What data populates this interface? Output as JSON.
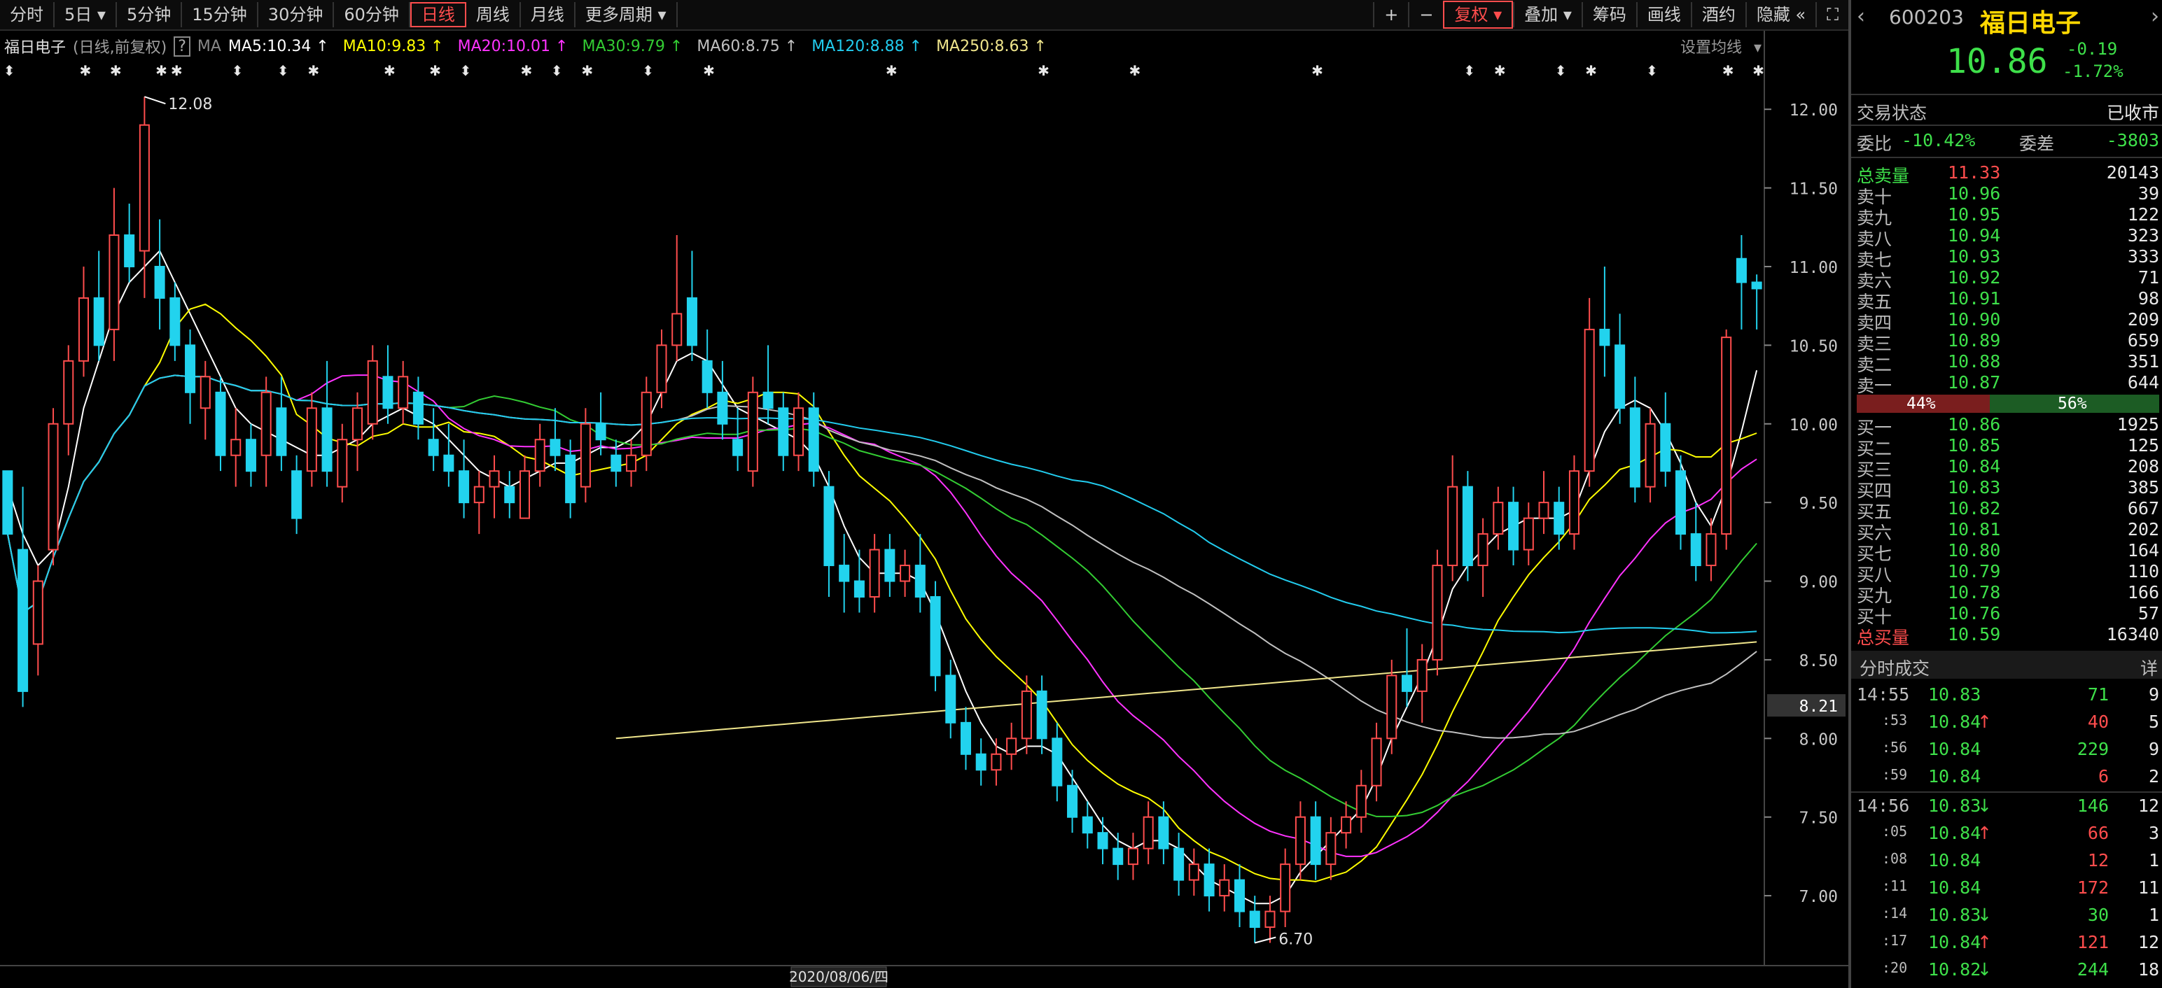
{
  "toolbar": {
    "periods": [
      "分时",
      "5日",
      "5分钟",
      "15分钟",
      "30分钟",
      "60分钟",
      "日线",
      "周线",
      "月线",
      "更多周期"
    ],
    "active": "日线",
    "right_buttons": [
      "+",
      "−",
      "复权",
      "叠加",
      "筹码",
      "画线",
      "酒约",
      "隐藏"
    ]
  },
  "legend": {
    "name": "福日电子",
    "mode": "(日线,前复权)",
    "help": "?",
    "ma_label": "MA",
    "items": [
      {
        "text": "MA5:10.34",
        "color": "#ffffff"
      },
      {
        "text": "MA10:9.83",
        "color": "#ffff00"
      },
      {
        "text": "MA20:10.01",
        "color": "#ff33ff"
      },
      {
        "text": "MA30:9.79",
        "color": "#33cc33"
      },
      {
        "text": "MA60:8.75",
        "color": "#c0c0c0"
      },
      {
        "text": "MA120:8.88",
        "color": "#22ccee"
      },
      {
        "text": "MA250:8.63",
        "color": "#f0e68c"
      }
    ],
    "settings": "设置均线"
  },
  "chart": {
    "y_ticks": [
      "12.00",
      "11.50",
      "11.00",
      "10.50",
      "10.00",
      "9.50",
      "9.00",
      "8.50",
      "8.00",
      "7.50",
      "7.00"
    ],
    "y_tick_values": [
      12.0,
      11.5,
      11.0,
      10.5,
      10.0,
      9.5,
      9.0,
      8.5,
      8.0,
      7.5,
      7.0
    ],
    "current_price_label": "8.21",
    "high_label": "12.08",
    "low_label": "6.70",
    "date_label": "2020/08/06/四"
  },
  "chart_data": {
    "type": "candlestick",
    "y_range": [
      6.6,
      12.25
    ],
    "visible_days": 118,
    "candles_ohlc": [
      [
        9.7,
        9.7,
        9.3,
        9.3
      ],
      [
        9.2,
        9.6,
        8.2,
        8.3
      ],
      [
        8.6,
        9.1,
        8.4,
        9.0
      ],
      [
        9.2,
        10.1,
        9.1,
        10.0
      ],
      [
        10.0,
        10.5,
        9.8,
        10.4
      ],
      [
        10.4,
        11.0,
        10.3,
        10.8
      ],
      [
        10.8,
        11.1,
        10.4,
        10.5
      ],
      [
        10.6,
        11.5,
        10.4,
        11.2
      ],
      [
        11.2,
        11.4,
        10.9,
        11.0
      ],
      [
        11.1,
        12.08,
        10.8,
        11.9
      ],
      [
        11.0,
        11.3,
        10.6,
        10.8
      ],
      [
        10.8,
        10.9,
        10.4,
        10.5
      ],
      [
        10.5,
        10.6,
        10.0,
        10.2
      ],
      [
        10.1,
        10.4,
        9.9,
        10.3
      ],
      [
        10.2,
        10.3,
        9.7,
        9.8
      ],
      [
        9.8,
        10.1,
        9.6,
        9.9
      ],
      [
        9.9,
        10.0,
        9.6,
        9.7
      ],
      [
        9.8,
        10.3,
        9.6,
        10.2
      ],
      [
        10.1,
        10.3,
        9.7,
        9.8
      ],
      [
        9.7,
        9.8,
        9.3,
        9.4
      ],
      [
        9.7,
        10.2,
        9.6,
        10.1
      ],
      [
        10.1,
        10.4,
        9.6,
        9.7
      ],
      [
        9.6,
        10.0,
        9.5,
        9.9
      ],
      [
        9.9,
        10.2,
        9.7,
        10.1
      ],
      [
        10.0,
        10.5,
        9.9,
        10.4
      ],
      [
        10.3,
        10.5,
        10.0,
        10.1
      ],
      [
        10.1,
        10.4,
        10.0,
        10.3
      ],
      [
        10.2,
        10.3,
        9.9,
        10.0
      ],
      [
        9.9,
        10.1,
        9.7,
        9.8
      ],
      [
        9.8,
        10.0,
        9.6,
        9.7
      ],
      [
        9.7,
        9.9,
        9.4,
        9.5
      ],
      [
        9.5,
        9.7,
        9.3,
        9.6
      ],
      [
        9.6,
        9.8,
        9.4,
        9.7
      ],
      [
        9.6,
        9.7,
        9.4,
        9.5
      ],
      [
        9.4,
        9.8,
        9.4,
        9.7
      ],
      [
        9.7,
        10.0,
        9.6,
        9.9
      ],
      [
        9.9,
        10.1,
        9.7,
        9.8
      ],
      [
        9.8,
        9.9,
        9.4,
        9.5
      ],
      [
        9.6,
        10.1,
        9.5,
        10.0
      ],
      [
        10.0,
        10.2,
        9.8,
        9.9
      ],
      [
        9.8,
        9.9,
        9.6,
        9.7
      ],
      [
        9.7,
        9.9,
        9.6,
        9.8
      ],
      [
        9.8,
        10.3,
        9.7,
        10.2
      ],
      [
        10.2,
        10.6,
        10.1,
        10.5
      ],
      [
        10.5,
        11.2,
        10.4,
        10.7
      ],
      [
        10.8,
        11.1,
        10.4,
        10.5
      ],
      [
        10.4,
        10.6,
        10.1,
        10.2
      ],
      [
        10.2,
        10.4,
        9.9,
        10.0
      ],
      [
        9.9,
        10.1,
        9.7,
        9.8
      ],
      [
        9.7,
        10.3,
        9.6,
        10.2
      ],
      [
        10.2,
        10.5,
        10.0,
        10.1
      ],
      [
        10.1,
        10.2,
        9.7,
        9.8
      ],
      [
        9.8,
        10.2,
        9.7,
        10.1
      ],
      [
        10.1,
        10.2,
        9.6,
        9.7
      ],
      [
        9.6,
        9.7,
        8.9,
        9.1
      ],
      [
        9.1,
        9.3,
        8.8,
        9.0
      ],
      [
        9.0,
        9.2,
        8.8,
        8.9
      ],
      [
        8.9,
        9.3,
        8.8,
        9.2
      ],
      [
        9.2,
        9.3,
        8.9,
        9.0
      ],
      [
        9.0,
        9.2,
        8.9,
        9.1
      ],
      [
        9.1,
        9.3,
        8.8,
        8.9
      ],
      [
        8.9,
        9.0,
        8.3,
        8.4
      ],
      [
        8.4,
        8.5,
        8.0,
        8.1
      ],
      [
        8.1,
        8.2,
        7.8,
        7.9
      ],
      [
        7.9,
        8.0,
        7.7,
        7.8
      ],
      [
        7.8,
        8.0,
        7.7,
        7.9
      ],
      [
        7.9,
        8.1,
        7.8,
        8.0
      ],
      [
        8.0,
        8.4,
        7.9,
        8.3
      ],
      [
        8.3,
        8.4,
        7.9,
        8.0
      ],
      [
        8.0,
        8.1,
        7.6,
        7.7
      ],
      [
        7.7,
        7.8,
        7.4,
        7.5
      ],
      [
        7.5,
        7.6,
        7.3,
        7.4
      ],
      [
        7.4,
        7.5,
        7.2,
        7.3
      ],
      [
        7.3,
        7.4,
        7.1,
        7.2
      ],
      [
        7.2,
        7.4,
        7.1,
        7.3
      ],
      [
        7.3,
        7.6,
        7.2,
        7.5
      ],
      [
        7.5,
        7.6,
        7.2,
        7.3
      ],
      [
        7.3,
        7.4,
        7.0,
        7.1
      ],
      [
        7.1,
        7.3,
        7.0,
        7.2
      ],
      [
        7.2,
        7.3,
        6.9,
        7.0
      ],
      [
        7.0,
        7.2,
        6.9,
        7.1
      ],
      [
        7.1,
        7.2,
        6.8,
        6.9
      ],
      [
        6.9,
        7.0,
        6.7,
        6.8
      ],
      [
        6.8,
        7.0,
        6.7,
        6.9
      ],
      [
        6.9,
        7.3,
        6.8,
        7.2
      ],
      [
        7.2,
        7.6,
        7.1,
        7.5
      ],
      [
        7.5,
        7.6,
        7.1,
        7.2
      ],
      [
        7.2,
        7.5,
        7.1,
        7.4
      ],
      [
        7.4,
        7.6,
        7.3,
        7.5
      ],
      [
        7.5,
        7.8,
        7.4,
        7.7
      ],
      [
        7.7,
        8.1,
        7.6,
        8.0
      ],
      [
        8.0,
        8.5,
        7.9,
        8.4
      ],
      [
        8.4,
        8.7,
        8.2,
        8.3
      ],
      [
        8.3,
        8.6,
        8.1,
        8.5
      ],
      [
        8.5,
        9.2,
        8.4,
        9.1
      ],
      [
        9.1,
        9.8,
        9.0,
        9.6
      ],
      [
        9.6,
        9.7,
        9.0,
        9.1
      ],
      [
        9.1,
        9.4,
        8.9,
        9.3
      ],
      [
        9.3,
        9.6,
        9.2,
        9.5
      ],
      [
        9.5,
        9.6,
        9.1,
        9.2
      ],
      [
        9.2,
        9.5,
        9.1,
        9.4
      ],
      [
        9.4,
        9.7,
        9.3,
        9.5
      ],
      [
        9.5,
        9.6,
        9.2,
        9.3
      ],
      [
        9.3,
        9.8,
        9.2,
        9.7
      ],
      [
        9.7,
        10.8,
        9.6,
        10.6
      ],
      [
        10.6,
        11.0,
        10.3,
        10.5
      ],
      [
        10.5,
        10.7,
        10.0,
        10.1
      ],
      [
        10.1,
        10.3,
        9.5,
        9.6
      ],
      [
        9.6,
        10.1,
        9.5,
        10.0
      ],
      [
        10.0,
        10.2,
        9.6,
        9.7
      ],
      [
        9.7,
        9.8,
        9.2,
        9.3
      ],
      [
        9.3,
        9.5,
        9.0,
        9.1
      ],
      [
        9.1,
        9.4,
        9.0,
        9.3
      ],
      [
        9.3,
        10.6,
        9.2,
        10.55
      ],
      [
        11.05,
        11.2,
        10.6,
        10.9
      ],
      [
        10.9,
        10.95,
        10.6,
        10.86
      ]
    ],
    "ma_series": {
      "MA5": [
        9.6,
        9.3,
        9.1,
        9.2,
        9.6,
        10.1,
        10.4,
        10.7,
        10.9,
        11.0,
        11.1,
        10.9,
        10.7,
        10.5,
        10.3,
        10.1,
        10.0,
        9.95,
        9.9,
        9.85,
        9.8,
        9.8,
        9.85,
        9.9,
        10.0,
        10.05,
        10.1,
        10.05,
        10.0,
        9.9,
        9.8,
        9.7,
        9.65,
        9.6,
        9.65,
        9.7,
        9.75,
        9.75,
        9.8,
        9.85,
        9.85,
        9.9,
        10.0,
        10.2,
        10.4,
        10.45,
        10.4,
        10.25,
        10.1,
        10.05,
        10.0,
        9.95,
        9.9,
        9.8,
        9.6,
        9.35,
        9.15,
        9.05,
        9.05,
        9.05,
        9.0,
        8.8,
        8.55,
        8.3,
        8.1,
        7.95,
        7.9,
        7.95,
        7.95,
        7.9,
        7.75,
        7.6,
        7.45,
        7.35,
        7.3,
        7.35,
        7.35,
        7.3,
        7.2,
        7.1,
        7.05,
        7.0,
        6.95,
        6.95,
        7.0,
        7.15,
        7.25,
        7.35,
        7.45,
        7.55,
        7.75,
        8.0,
        8.2,
        8.4,
        8.65,
        8.95,
        9.1,
        9.2,
        9.3,
        9.35,
        9.4,
        9.4,
        9.4,
        9.45,
        9.7,
        9.95,
        10.1,
        10.15,
        10.1,
        9.95,
        9.75,
        9.5,
        9.35,
        9.6,
        9.95,
        10.34
      ]
    }
  },
  "panel": {
    "code": "600203",
    "name": "福日电子",
    "price": "10.86",
    "change": "-0.19",
    "change_pct": "-1.72%",
    "status_label": "交易状态",
    "status_value": "已收市",
    "ratio_label": "委比",
    "ratio_value": "-10.42%",
    "diff_label": "委差",
    "diff_value": "-3803",
    "sell_total": {
      "label": "总卖量",
      "price": "11.33",
      "vol": "20143"
    },
    "sells": [
      {
        "label": "卖十",
        "price": "10.96",
        "vol": "39"
      },
      {
        "label": "卖九",
        "price": "10.95",
        "vol": "122"
      },
      {
        "label": "卖八",
        "price": "10.94",
        "vol": "323"
      },
      {
        "label": "卖七",
        "price": "10.93",
        "vol": "333"
      },
      {
        "label": "卖六",
        "price": "10.92",
        "vol": "71"
      },
      {
        "label": "卖五",
        "price": "10.91",
        "vol": "98"
      },
      {
        "label": "卖四",
        "price": "10.90",
        "vol": "209"
      },
      {
        "label": "卖三",
        "price": "10.89",
        "vol": "659"
      },
      {
        "label": "卖二",
        "price": "10.88",
        "vol": "351"
      },
      {
        "label": "卖一",
        "price": "10.87",
        "vol": "644"
      }
    ],
    "bar_left": "44%",
    "bar_right": "56%",
    "bar_left_fraction": 0.44,
    "buys": [
      {
        "label": "买一",
        "price": "10.86",
        "vol": "1925"
      },
      {
        "label": "买二",
        "price": "10.85",
        "vol": "125"
      },
      {
        "label": "买三",
        "price": "10.84",
        "vol": "208"
      },
      {
        "label": "买四",
        "price": "10.83",
        "vol": "385"
      },
      {
        "label": "买五",
        "price": "10.82",
        "vol": "667"
      },
      {
        "label": "买六",
        "price": "10.81",
        "vol": "202"
      },
      {
        "label": "买七",
        "price": "10.80",
        "vol": "164"
      },
      {
        "label": "买八",
        "price": "10.79",
        "vol": "110"
      },
      {
        "label": "买九",
        "price": "10.78",
        "vol": "166"
      },
      {
        "label": "买十",
        "price": "10.76",
        "vol": "57"
      }
    ],
    "buy_total": {
      "label": "总买量",
      "price": "10.59",
      "vol": "16340"
    },
    "ticks_title": "分时成交",
    "ticks_detail": "详",
    "ticks": [
      {
        "time": "14:55",
        "price": "10.83",
        "arrow": "",
        "vol": "71",
        "n": "9",
        "vol_color": "#3ee04a"
      },
      {
        "time": ":53",
        "price": "10.84",
        "arrow": "up",
        "vol": "40",
        "n": "5",
        "vol_color": "#ff4d4d"
      },
      {
        "time": ":56",
        "price": "10.84",
        "arrow": "",
        "vol": "229",
        "n": "9",
        "vol_color": "#3ee04a"
      },
      {
        "time": ":59",
        "price": "10.84",
        "arrow": "",
        "vol": "6",
        "n": "2",
        "vol_color": "#ff4d4d"
      },
      {
        "time": "14:56",
        "price": "10.83",
        "arrow": "down",
        "vol": "146",
        "n": "12",
        "vol_color": "#3ee04a"
      },
      {
        "time": ":05",
        "price": "10.84",
        "arrow": "up",
        "vol": "66",
        "n": "3",
        "vol_color": "#ff4d4d"
      },
      {
        "time": ":08",
        "price": "10.84",
        "arrow": "",
        "vol": "12",
        "n": "1",
        "vol_color": "#ff4d4d"
      },
      {
        "time": ":11",
        "price": "10.84",
        "arrow": "",
        "vol": "172",
        "n": "11",
        "vol_color": "#ff4d4d"
      },
      {
        "time": ":14",
        "price": "10.83",
        "arrow": "down",
        "vol": "30",
        "n": "1",
        "vol_color": "#3ee04a"
      },
      {
        "time": ":17",
        "price": "10.84",
        "arrow": "up",
        "vol": "121",
        "n": "12",
        "vol_color": "#ff4d4d"
      },
      {
        "time": ":20",
        "price": "10.82",
        "arrow": "down",
        "vol": "244",
        "n": "18",
        "vol_color": "#3ee04a"
      }
    ]
  }
}
